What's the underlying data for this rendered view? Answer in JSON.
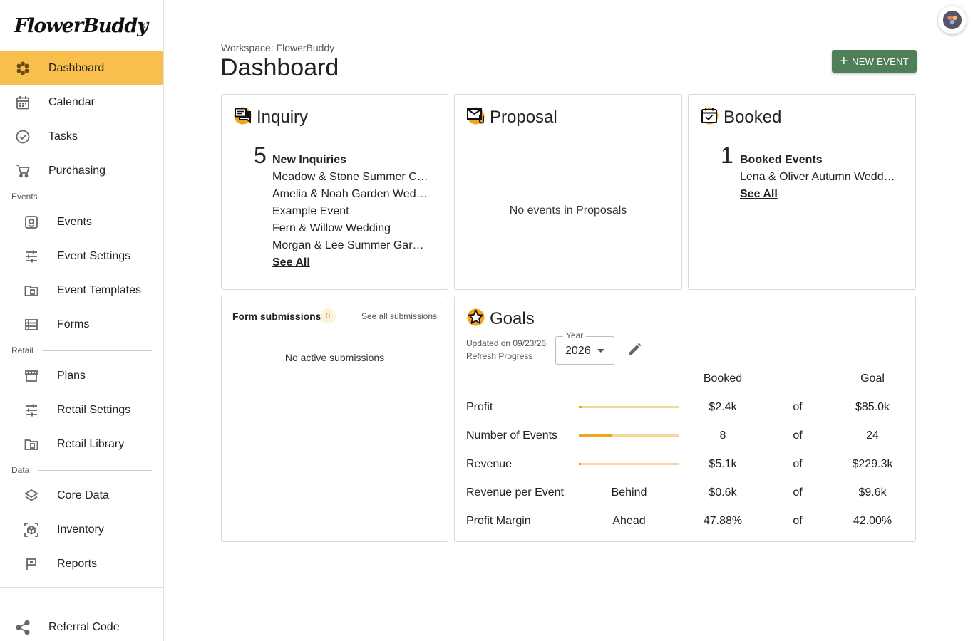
{
  "app": {
    "logo": "FlowerBuddy"
  },
  "sidebar": {
    "top_items": [
      {
        "label": "Dashboard",
        "icon": "flower-icon",
        "active": true
      },
      {
        "label": "Calendar",
        "icon": "calendar-icon"
      },
      {
        "label": "Tasks",
        "icon": "check-circle-icon"
      },
      {
        "label": "Purchasing",
        "icon": "cart-icon"
      }
    ],
    "events_section": "Events",
    "events_items": [
      {
        "label": "Events",
        "icon": "event-box-icon"
      },
      {
        "label": "Event Settings",
        "icon": "sliders-icon"
      },
      {
        "label": "Event Templates",
        "icon": "folder-doc-icon"
      },
      {
        "label": "Forms",
        "icon": "list-icon"
      }
    ],
    "retail_section": "Retail",
    "retail_items": [
      {
        "label": "Plans",
        "icon": "store-icon"
      },
      {
        "label": "Retail Settings",
        "icon": "sliders-icon"
      },
      {
        "label": "Retail Library",
        "icon": "folder-doc-icon"
      }
    ],
    "data_section": "Data",
    "data_items": [
      {
        "label": "Core Data",
        "icon": "layers-icon"
      },
      {
        "label": "Inventory",
        "icon": "cube-icon"
      },
      {
        "label": "Reports",
        "icon": "flag-icon"
      }
    ],
    "referral": {
      "label": "Referral Code",
      "icon": "share-icon"
    }
  },
  "header": {
    "workspace": "Workspace: FlowerBuddy",
    "title": "Dashboard",
    "new_event": "NEW EVENT"
  },
  "inquiry": {
    "title": "Inquiry",
    "count": "5",
    "list_title": "New Inquiries",
    "items": [
      "Meadow & Stone Summer Celebration",
      "Amelia & Noah Garden Wedding",
      "Example Event",
      "Fern & Willow Wedding",
      "Morgan & Lee Summer Garden Party"
    ],
    "see_all": "See All"
  },
  "proposal": {
    "title": "Proposal",
    "empty": "No events in Proposals"
  },
  "booked": {
    "title": "Booked",
    "count": "1",
    "list_title": "Booked Events",
    "items": [
      "Lena & Oliver Autumn Wedding"
    ],
    "see_all": "See All"
  },
  "form_submissions": {
    "title": "Form submissions",
    "count": "0",
    "link": "See all submissions",
    "empty": "No active submissions"
  },
  "goals": {
    "title": "Goals",
    "updated": "Updated on 09/23/26",
    "refresh": "Refresh Progress",
    "year_label": "Year",
    "year_value": "2026",
    "col_booked": "Booked",
    "col_goal": "Goal",
    "of": "of",
    "rows": [
      {
        "label": "Profit",
        "progress": 0.028,
        "booked": "$2.4k",
        "goal": "$85.0k"
      },
      {
        "label": "Number of Events",
        "progress": 0.333,
        "booked": "8",
        "goal": "24"
      },
      {
        "label": "Revenue",
        "progress": 0.022,
        "booked": "$5.1k",
        "goal": "$229.3k"
      },
      {
        "label": "Revenue per Event",
        "status": "Behind",
        "booked": "$0.6k",
        "goal": "$9.6k"
      },
      {
        "label": "Profit Margin",
        "status": "Ahead",
        "booked": "47.88%",
        "goal": "42.00%"
      }
    ]
  },
  "colors": {
    "accent": "#f8bf4d",
    "primary_button": "#4f7f57",
    "progress": "#f2a51c",
    "progress_track": "#f6d79a"
  }
}
